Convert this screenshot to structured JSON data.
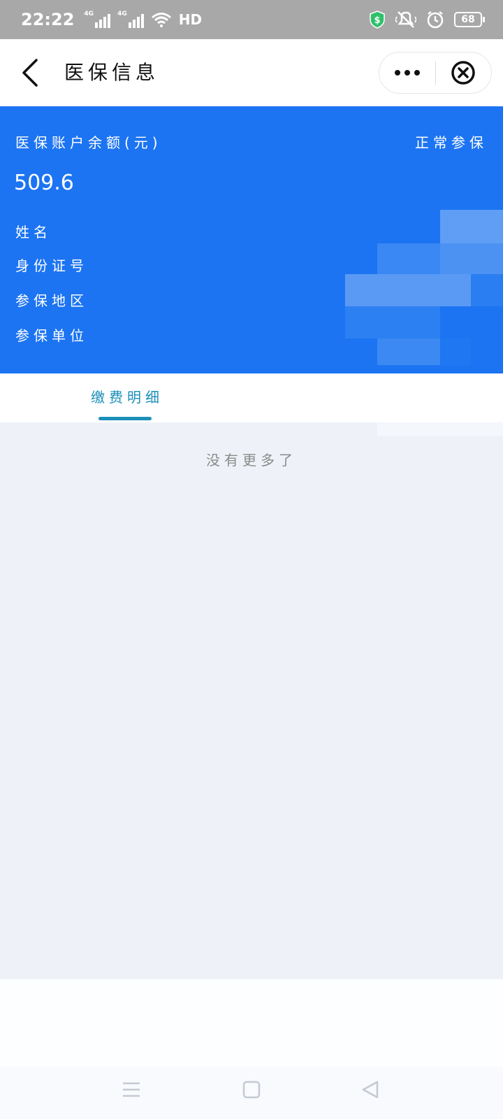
{
  "status_bar": {
    "time": "22:22",
    "network_1": "4G",
    "network_2": "4G",
    "hd_label": "HD",
    "battery_level": "68"
  },
  "nav_bar": {
    "title": "医保信息"
  },
  "account_card": {
    "balance_label": "医保账户余额(元)",
    "insurance_status": "正常参保",
    "balance_value": "509.6",
    "name_label": "姓名",
    "id_number_label": "身份证号",
    "region_label": "参保地区",
    "employer_label": "参保单位",
    "background_color": "#1c74f2"
  },
  "tabs": {
    "payment_details": "缴费明细",
    "accent_color": "#1a8fb8"
  },
  "list": {
    "empty_hint": "没有更多了"
  }
}
